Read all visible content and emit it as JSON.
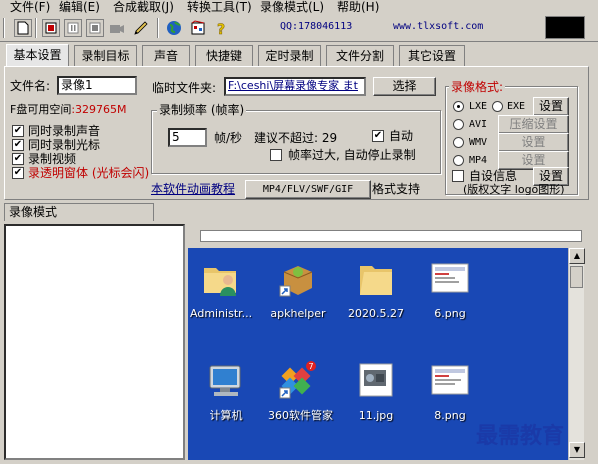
{
  "menu": [
    "文件(F)",
    "编辑(E)",
    "合成截取(J)",
    "转换工具(T)",
    "录像模式(L)",
    "帮助(H)"
  ],
  "toolbar": {
    "qq": "QQ:178046113",
    "site": "www.tlxsoft.com"
  },
  "tabs": [
    "基本设置",
    "录制目标",
    "声音",
    "快捷键",
    "定时录制",
    "文件分割",
    "其它设置"
  ],
  "basic": {
    "filename_label": "文件名:",
    "filename_value": "录像1",
    "tempdir_label": "临时文件夹:",
    "tempdir_value": "F:\\ceshi\\屏幕录像专家 まt",
    "choose_btn": "选择",
    "free_space_label": "F盘可用空间",
    "free_space_value": ":329765M",
    "check_audio": "同时录制声音",
    "check_cursor": "同时录制光标",
    "check_video": "录制视频",
    "check_transparent": "录透明窗体 (光标会闪)",
    "freq_group": "录制频率 (帧率)",
    "fps_value": "5",
    "fps_unit": "帧/秒",
    "suggest": "建议不超过: 29",
    "auto_label": "自动",
    "auto_stop": "帧率过大, 自动停止录制",
    "tutorial_link": "本软件动画教程",
    "formats_btn": "MP4/FLV/SWF/GIF",
    "formats_support": "格式支持"
  },
  "format_group": {
    "title": "录像格式:",
    "lxe": "LXE",
    "exe": "EXE",
    "avi": "AVI",
    "wmv": "WMV",
    "mp4": "MP4",
    "settings": "设置",
    "compress_settings": "压缩设置",
    "custom_info": "自设信息",
    "copyright": "(版权文字 logo图形)"
  },
  "status_tab": "录像模式",
  "desktop_icons": [
    {
      "label": "Administr..."
    },
    {
      "label": "apkhelper"
    },
    {
      "label": "2020.5.27"
    },
    {
      "label": "6.png"
    },
    {
      "label": "计算机"
    },
    {
      "label": "360软件管家"
    },
    {
      "label": "11.jpg"
    },
    {
      "label": "8.png"
    }
  ],
  "watermark": "最需教育"
}
